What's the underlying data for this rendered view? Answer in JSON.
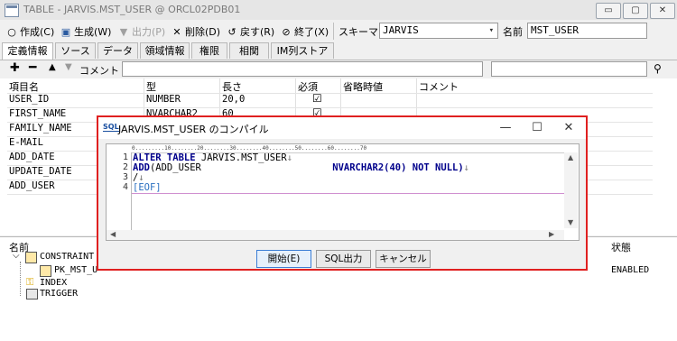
{
  "window": {
    "title": "TABLE - JARVIS.MST_USER @ ORCL02PDB01",
    "controls": [
      "▭",
      "▢",
      "✕"
    ]
  },
  "toolbar": {
    "create_label": "作成(C)",
    "generate_label": "生成(W)",
    "output_label": "出力(P)",
    "delete_label": "削除(D)",
    "revert_label": "戻す(R)",
    "close_label": "終了(X)",
    "schema_label": "スキーマ",
    "schema_value": "JARVIS",
    "name_label": "名前",
    "name_value": "MST_USER"
  },
  "tabs": [
    "定義情報",
    "ソース",
    "データ",
    "領域情報",
    "権限",
    "相関",
    "IM列ストア"
  ],
  "editbar": {
    "comment_label": "コメント"
  },
  "grid": {
    "headers": [
      "項目名",
      "型",
      "長さ",
      "必須",
      "省略時値",
      "コメント"
    ],
    "rows": [
      {
        "name": "USER_ID",
        "type": "NUMBER",
        "length": "20,0",
        "required": "☑"
      },
      {
        "name": "FIRST_NAME",
        "type": "NVARCHAR2",
        "length": "60",
        "required": "☑"
      },
      {
        "name": "FAMILY_NAME",
        "type": "",
        "length": "",
        "required": ""
      },
      {
        "name": "E-MAIL",
        "type": "",
        "length": "",
        "required": ""
      },
      {
        "name": "ADD_DATE",
        "type": "",
        "length": "",
        "required": ""
      },
      {
        "name": "UPDATE_DATE",
        "type": "",
        "length": "",
        "required": ""
      },
      {
        "name": "ADD_USER",
        "type": "",
        "length": "",
        "required": ""
      }
    ]
  },
  "lower": {
    "name_header": "名前",
    "status_header": "状態",
    "tree": [
      "CONSTRAINT",
      "PK_MST_U",
      "INDEX",
      "TRIGGER"
    ],
    "status_value": "ENABLED"
  },
  "dialog": {
    "icon_text": "SQL",
    "title": "JARVIS.MST_USER のコンパイル",
    "ruler": "0.........10........20........30........40........50........60........70",
    "lines": [
      {
        "num": "1",
        "kw": "ALTER TABLE",
        "rest": " JARVIS.MST_USER",
        "mark": "↓"
      },
      {
        "num": "2",
        "kw": "ADD",
        "rest": "(ADD_USER                       ",
        "type": "NVARCHAR2(40)",
        "tail": " NOT NULL)",
        "mark": "↓"
      },
      {
        "num": "3",
        "kw": "",
        "rest": "/",
        "mark": "↓"
      },
      {
        "num": "4",
        "kw": "",
        "rest": "[EOF]",
        "mark": ""
      }
    ],
    "buttons": {
      "start": "開始(E)",
      "sql_output": "SQL出力",
      "cancel": "キャンセル"
    }
  }
}
